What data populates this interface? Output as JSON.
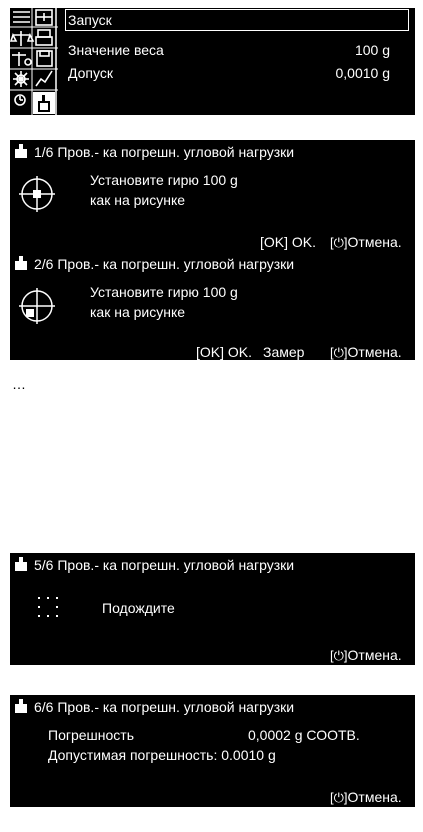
{
  "top": {
    "menu": [
      "Запуск",
      "Значение веса",
      "Допуск"
    ],
    "values": [
      "100 g",
      "0,0010 g"
    ]
  },
  "step1": {
    "header": "1/6 Пров.- ка погрешн. угловой нагрузки",
    "line1": "Установите гирю 100 g",
    "line2": "как на рисунке",
    "ok": "[OK] OK.",
    "cancel": "Отмена."
  },
  "step2": {
    "header": "2/6 Пров.- ка погрешн. угловой нагрузки",
    "line1": "Установите гирю 100 g",
    "line2": "как на рисунке",
    "ok": "[OK] OK.",
    "measure": "Замер",
    "cancel": "Отмена."
  },
  "ellipsis": "…",
  "step5": {
    "header": "5/6 Пров.- ка погрешн. угловой нагрузки",
    "wait": "Подождите",
    "cancel": "Отмена."
  },
  "step6": {
    "header": "6/6 Пров.- ка погрешн. угловой нагрузки",
    "label1": "Погрешность",
    "value1": "0,0002 g  СООТВ.",
    "label2": "Допустимая погрешность: 0.0010 g",
    "cancel": "Отмена."
  }
}
